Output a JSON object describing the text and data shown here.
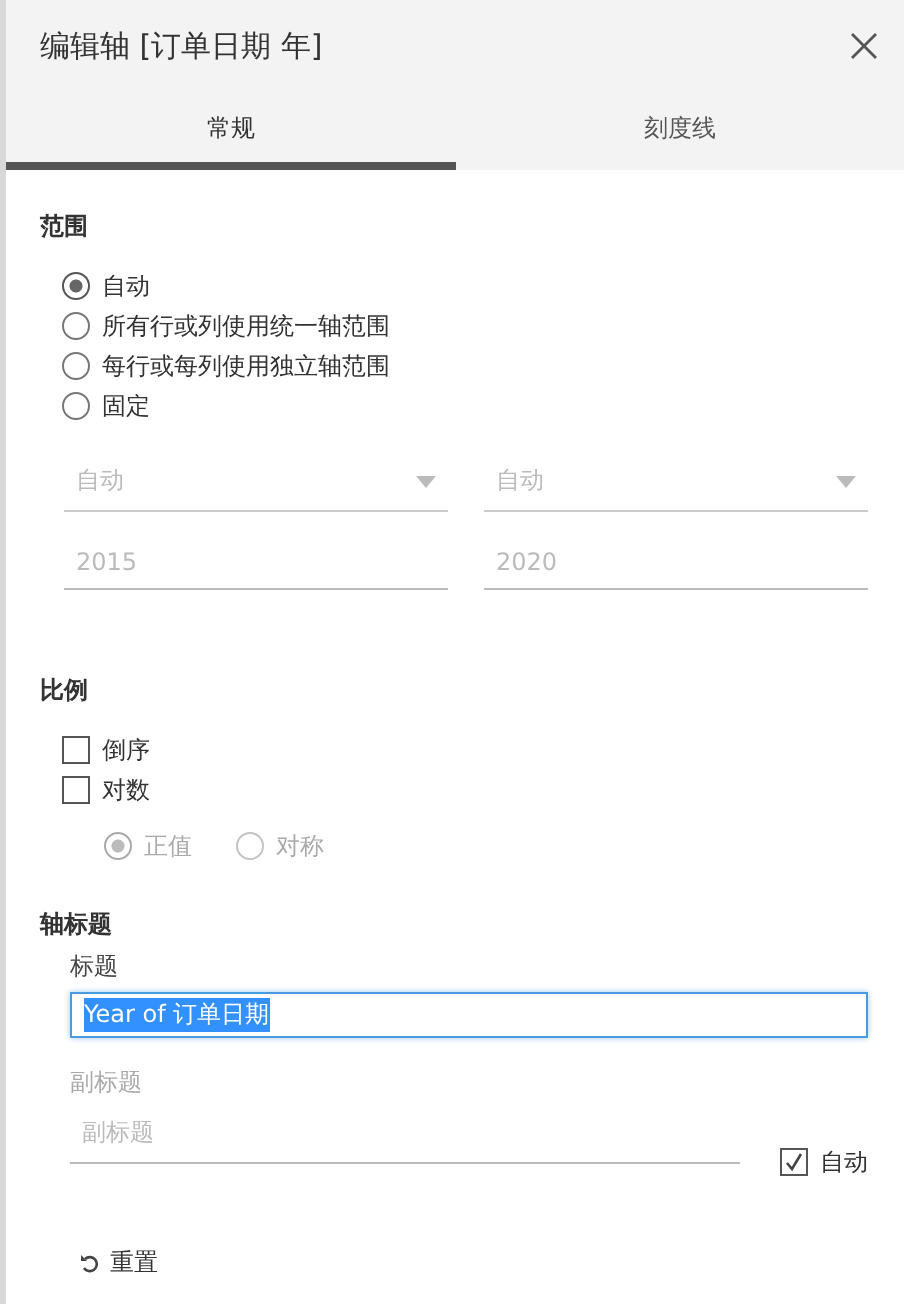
{
  "dialog": {
    "title": "编辑轴 [订单日期 年]"
  },
  "tabs": [
    {
      "label": "常规",
      "selected": true
    },
    {
      "label": "刻度线",
      "selected": false
    }
  ],
  "range": {
    "heading": "范围",
    "options": [
      {
        "label": "自动",
        "selected": true
      },
      {
        "label": "所有行或列使用统一轴范围",
        "selected": false
      },
      {
        "label": "每行或每列使用独立轴范围",
        "selected": false
      },
      {
        "label": "固定",
        "selected": false
      }
    ],
    "disabled": true,
    "dropdowns": [
      "自动",
      "自动"
    ],
    "values": [
      "2015",
      "2020"
    ]
  },
  "scale": {
    "heading": "比例",
    "checkboxes": [
      {
        "label": "倒序",
        "checked": false
      },
      {
        "label": "对数",
        "checked": false
      }
    ],
    "sub_disabled": true,
    "sub_options": [
      {
        "label": "正值",
        "selected": true
      },
      {
        "label": "对称",
        "selected": false
      }
    ]
  },
  "axis_title": {
    "heading": "轴标题",
    "title_label": "标题",
    "title_value": "Year of 订单日期",
    "title_text_selected": true,
    "subtitle_label": "副标题",
    "subtitle_placeholder": "副标题",
    "auto": {
      "label": "自动",
      "checked": true
    }
  },
  "reset": "重置"
}
